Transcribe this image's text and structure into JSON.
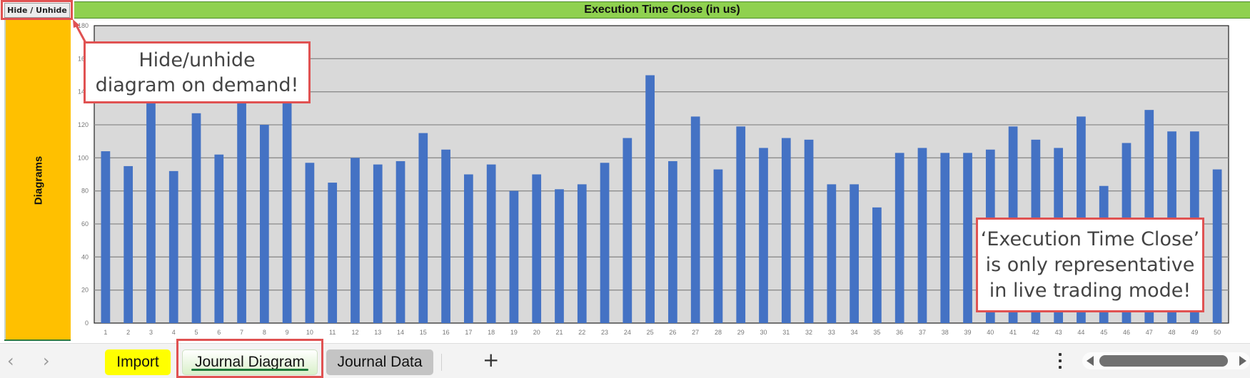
{
  "sheet": {
    "hide_button_label": "Hide / Unhide",
    "side_panel_label": "Diagrams",
    "colors": {
      "title_bar": "#8fd14f",
      "side_panel": "#ffc000",
      "bar": "#4472c4",
      "plot_bg": "#d9d9d9",
      "callout_border": "#e05252"
    }
  },
  "callouts": {
    "hide_unhide": [
      "Hide/unhide",
      "diagram on demand!"
    ],
    "execution_note": [
      "‘Execution Time Close’",
      "is only representative",
      "in live trading mode!"
    ]
  },
  "chart_data": {
    "type": "bar",
    "title": "Execution Time Close (in us)",
    "xlabel": "",
    "ylabel": "",
    "ylim": [
      0,
      180
    ],
    "yticks": [
      0,
      20,
      40,
      60,
      80,
      100,
      120,
      140,
      160,
      180
    ],
    "grid": true,
    "legend": "none",
    "categories": [
      "1",
      "2",
      "3",
      "4",
      "5",
      "6",
      "7",
      "8",
      "9",
      "10",
      "11",
      "12",
      "13",
      "14",
      "15",
      "16",
      "17",
      "18",
      "19",
      "20",
      "21",
      "22",
      "23",
      "24",
      "25",
      "26",
      "27",
      "28",
      "29",
      "30",
      "31",
      "32",
      "33",
      "34",
      "35",
      "36",
      "37",
      "38",
      "39",
      "40",
      "41",
      "42",
      "43",
      "44",
      "45",
      "46",
      "47",
      "48",
      "49",
      "50"
    ],
    "values": [
      104,
      95,
      135,
      92,
      127,
      102,
      136,
      120,
      135,
      97,
      85,
      100,
      96,
      98,
      115,
      105,
      90,
      96,
      80,
      90,
      81,
      84,
      97,
      112,
      150,
      98,
      125,
      93,
      119,
      106,
      112,
      111,
      84,
      84,
      70,
      103,
      106,
      103,
      103,
      105,
      119,
      111,
      106,
      125,
      83,
      109,
      129,
      116,
      116,
      93
    ]
  },
  "tabbar": {
    "prev_icon": "‹",
    "next_icon": "›",
    "tabs": [
      {
        "label": "Import",
        "active": false
      },
      {
        "label": "Journal Diagram",
        "active": true
      },
      {
        "label": "Journal Data",
        "active": false
      }
    ],
    "add_sheet_icon": "+"
  }
}
